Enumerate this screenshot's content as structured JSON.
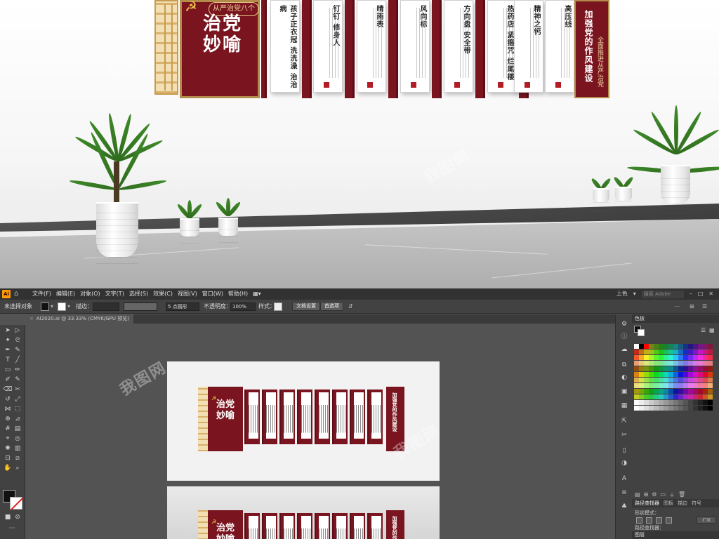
{
  "scene": {
    "main_panel_tag": "从严治党八个",
    "main_panel_title": "治党妙喻",
    "cards": [
      "孩子正衣冠 洗洗澡 治治病",
      "钉钉 修身人",
      "晴雨表",
      "风向标",
      "方向盘 安全带",
      "热药店 紧箍咒 烂尾楼",
      "精神之钙",
      "高压线"
    ],
    "right_panel_title": "加强党的作风建设",
    "right_panel_sub": "全面推进从严治党",
    "watermark": "我图网"
  },
  "menubar": {
    "logo": "Ai",
    "menus": [
      "文件(F)",
      "编辑(E)",
      "对象(O)",
      "文字(T)",
      "选择(S)",
      "效果(C)",
      "视图(V)",
      "窗口(W)",
      "帮助(H)"
    ],
    "workspace": "上色",
    "search_placeholder": "搜索 Adobe Stock"
  },
  "controlbar": {
    "selection_label": "未选择对象",
    "stroke_label": "描边：",
    "stroke_value": "",
    "brush_value": "5 点圆形",
    "opacity_label": "不透明度：",
    "opacity_value": "100%",
    "style_label": "样式：",
    "doc_setup": "文档设置",
    "preferences": "首选项"
  },
  "document_tab": {
    "close": "×",
    "label": "AI2020.ai @ 33.33% (CMYK/GPU 预览)"
  },
  "artboard": {
    "mini_title": "治党妙喻",
    "mini_right": "加强党的作风建设"
  },
  "panel": {
    "swatches_title": "色板",
    "path_tabs": [
      "路径查找器",
      "图板",
      "描边",
      "符号"
    ],
    "shape_modes_label": "形状模式：",
    "expand_label": "扩展",
    "pathfinder_label": "路径查找器：",
    "layers_title": "图层"
  },
  "colors": {
    "accent_red": "#7a1520",
    "gold": "#d8b26a",
    "ai_orange": "#ff9a00"
  }
}
